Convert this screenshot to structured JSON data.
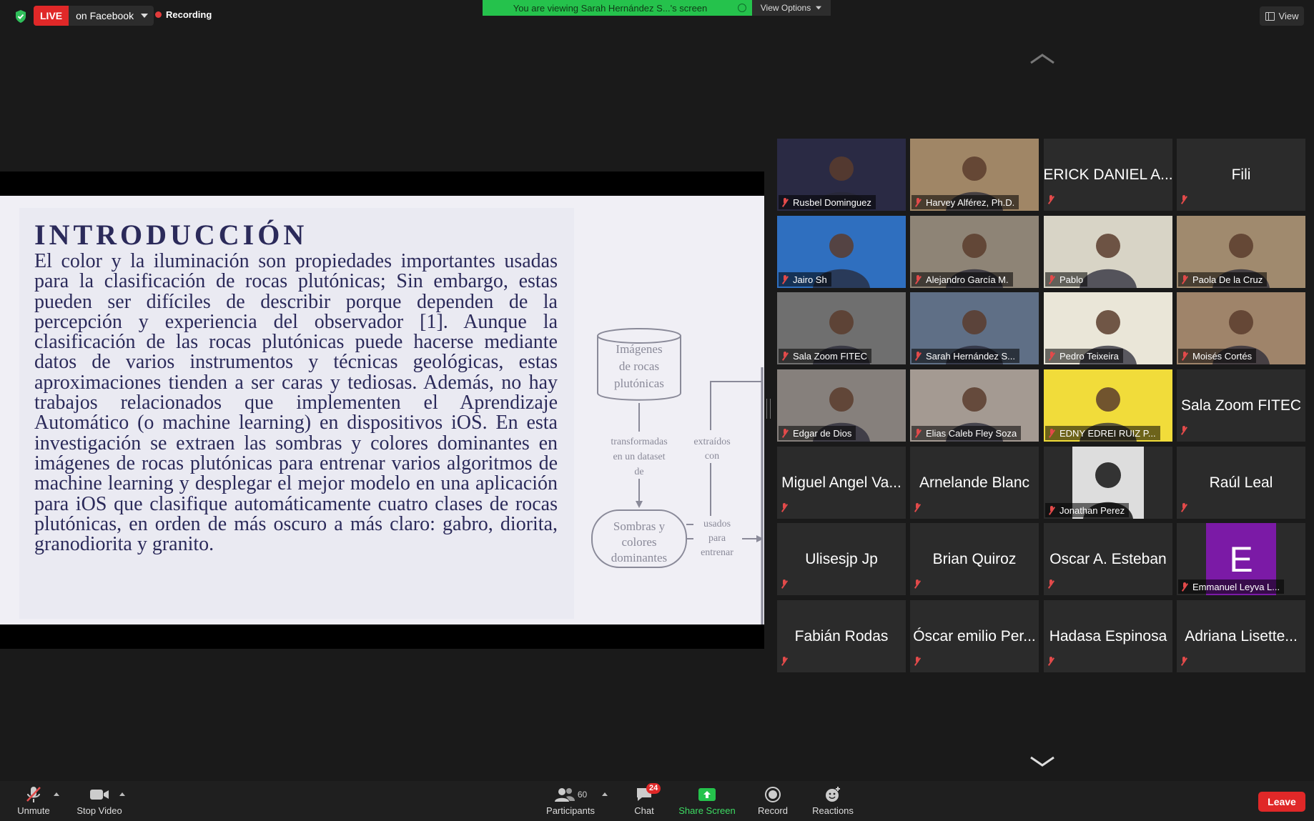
{
  "topbar": {
    "live_badge": "LIVE",
    "live_destination": "on Facebook",
    "recording": "Recording",
    "share_banner": "You are viewing Sarah Hernández S...'s screen",
    "view_options": "View Options",
    "view": "View"
  },
  "slide": {
    "title": "INTRODUCCIÓN",
    "body": "El color y la iluminación son propiedades importantes usadas para la clasificación de rocas plutónicas; Sin embargo, estas pueden ser difíciles de describir porque dependen de la percepción y experiencia del observador [1]. Aunque la clasificación de las rocas plutónicas puede hacerse mediante datos de varios instrumentos y técnicas geológicas, estas aproximaciones tienden a ser caras y tediosas. Además, no hay trabajos relacionados que implementen el Aprendizaje Automático (o machine learning) en dispositivos iOS. En esta investigación se extraen las sombras y colores dominantes en imágenes de rocas plutónicas para entrenar varios algoritmos de machine learning y desplegar el mejor modelo en una aplicación para iOS que clasifique automáticamente cuatro clases de rocas plutónicas, en orden de más oscuro a más claro: gabro, diorita, granodiorita y granito.",
    "diagram": {
      "db_line1": "Imágenes",
      "db_line2": "de rocas",
      "db_line3": "plutónicas",
      "arrow1_line1": "transformadas",
      "arrow1_line2": "en un dataset",
      "arrow1_line3": "de",
      "extract_line1": "extraídos",
      "extract_line2": "con",
      "node_line1": "Sombras y",
      "node_line2": "colores",
      "node_line3": "dominantes",
      "used_line1": "usados",
      "used_line2": "para",
      "used_line3": "entrenar"
    }
  },
  "participants": [
    {
      "name": "Rusbel Dominguez",
      "video": true
    },
    {
      "name": "Harvey Alférez, Ph.D.",
      "video": true
    },
    {
      "name": "ERICK DANIEL A...",
      "video": false
    },
    {
      "name": "Fili",
      "video": false
    },
    {
      "name": "Jairo Sh",
      "video": true
    },
    {
      "name": "Alejandro García M.",
      "video": true
    },
    {
      "name": "Pablo",
      "video": true
    },
    {
      "name": "Paola De la Cruz",
      "video": true
    },
    {
      "name": "Sala Zoom FITEC",
      "video": true
    },
    {
      "name": "Sarah Hernández S...",
      "video": true
    },
    {
      "name": "Pedro Teixeira",
      "video": true
    },
    {
      "name": "Moisés Cortés",
      "video": true
    },
    {
      "name": "Edgar de Dios",
      "video": true
    },
    {
      "name": "Elias Caleb Fley Soza",
      "video": true
    },
    {
      "name": "EDNY EDREI RUIZ P...",
      "video": true
    },
    {
      "name": "Sala Zoom FITEC",
      "video": false
    },
    {
      "name": "Miguel Angel Va...",
      "video": false
    },
    {
      "name": "Arnelande Blanc",
      "video": false
    },
    {
      "name": "Jonathan Perez",
      "video": true
    },
    {
      "name": "Raúl Leal",
      "video": false
    },
    {
      "name": "Ulisesjp Jp",
      "video": false
    },
    {
      "name": "Brian Quiroz",
      "video": false
    },
    {
      "name": "Oscar A. Esteban",
      "video": false
    },
    {
      "name": "Emmanuel Leyva L...",
      "video": false,
      "avatar_letter": "E"
    },
    {
      "name": "Fabián Rodas",
      "video": false
    },
    {
      "name": "Óscar emilio Per...",
      "video": false
    },
    {
      "name": "Hadasa Espinosa",
      "video": false
    },
    {
      "name": "Adriana Lisette...",
      "video": false
    }
  ],
  "toolbar": {
    "unmute": "Unmute",
    "stop_video": "Stop Video",
    "participants": "Participants",
    "participants_count": "60",
    "chat": "Chat",
    "chat_badge": "24",
    "share_screen": "Share Screen",
    "record": "Record",
    "reactions": "Reactions",
    "leave": "Leave"
  },
  "colors": {
    "live_red": "#e02828",
    "share_green": "#25c24c",
    "active_speaker": "#dfe98a",
    "avatar_purple": "#7b1aa6"
  }
}
